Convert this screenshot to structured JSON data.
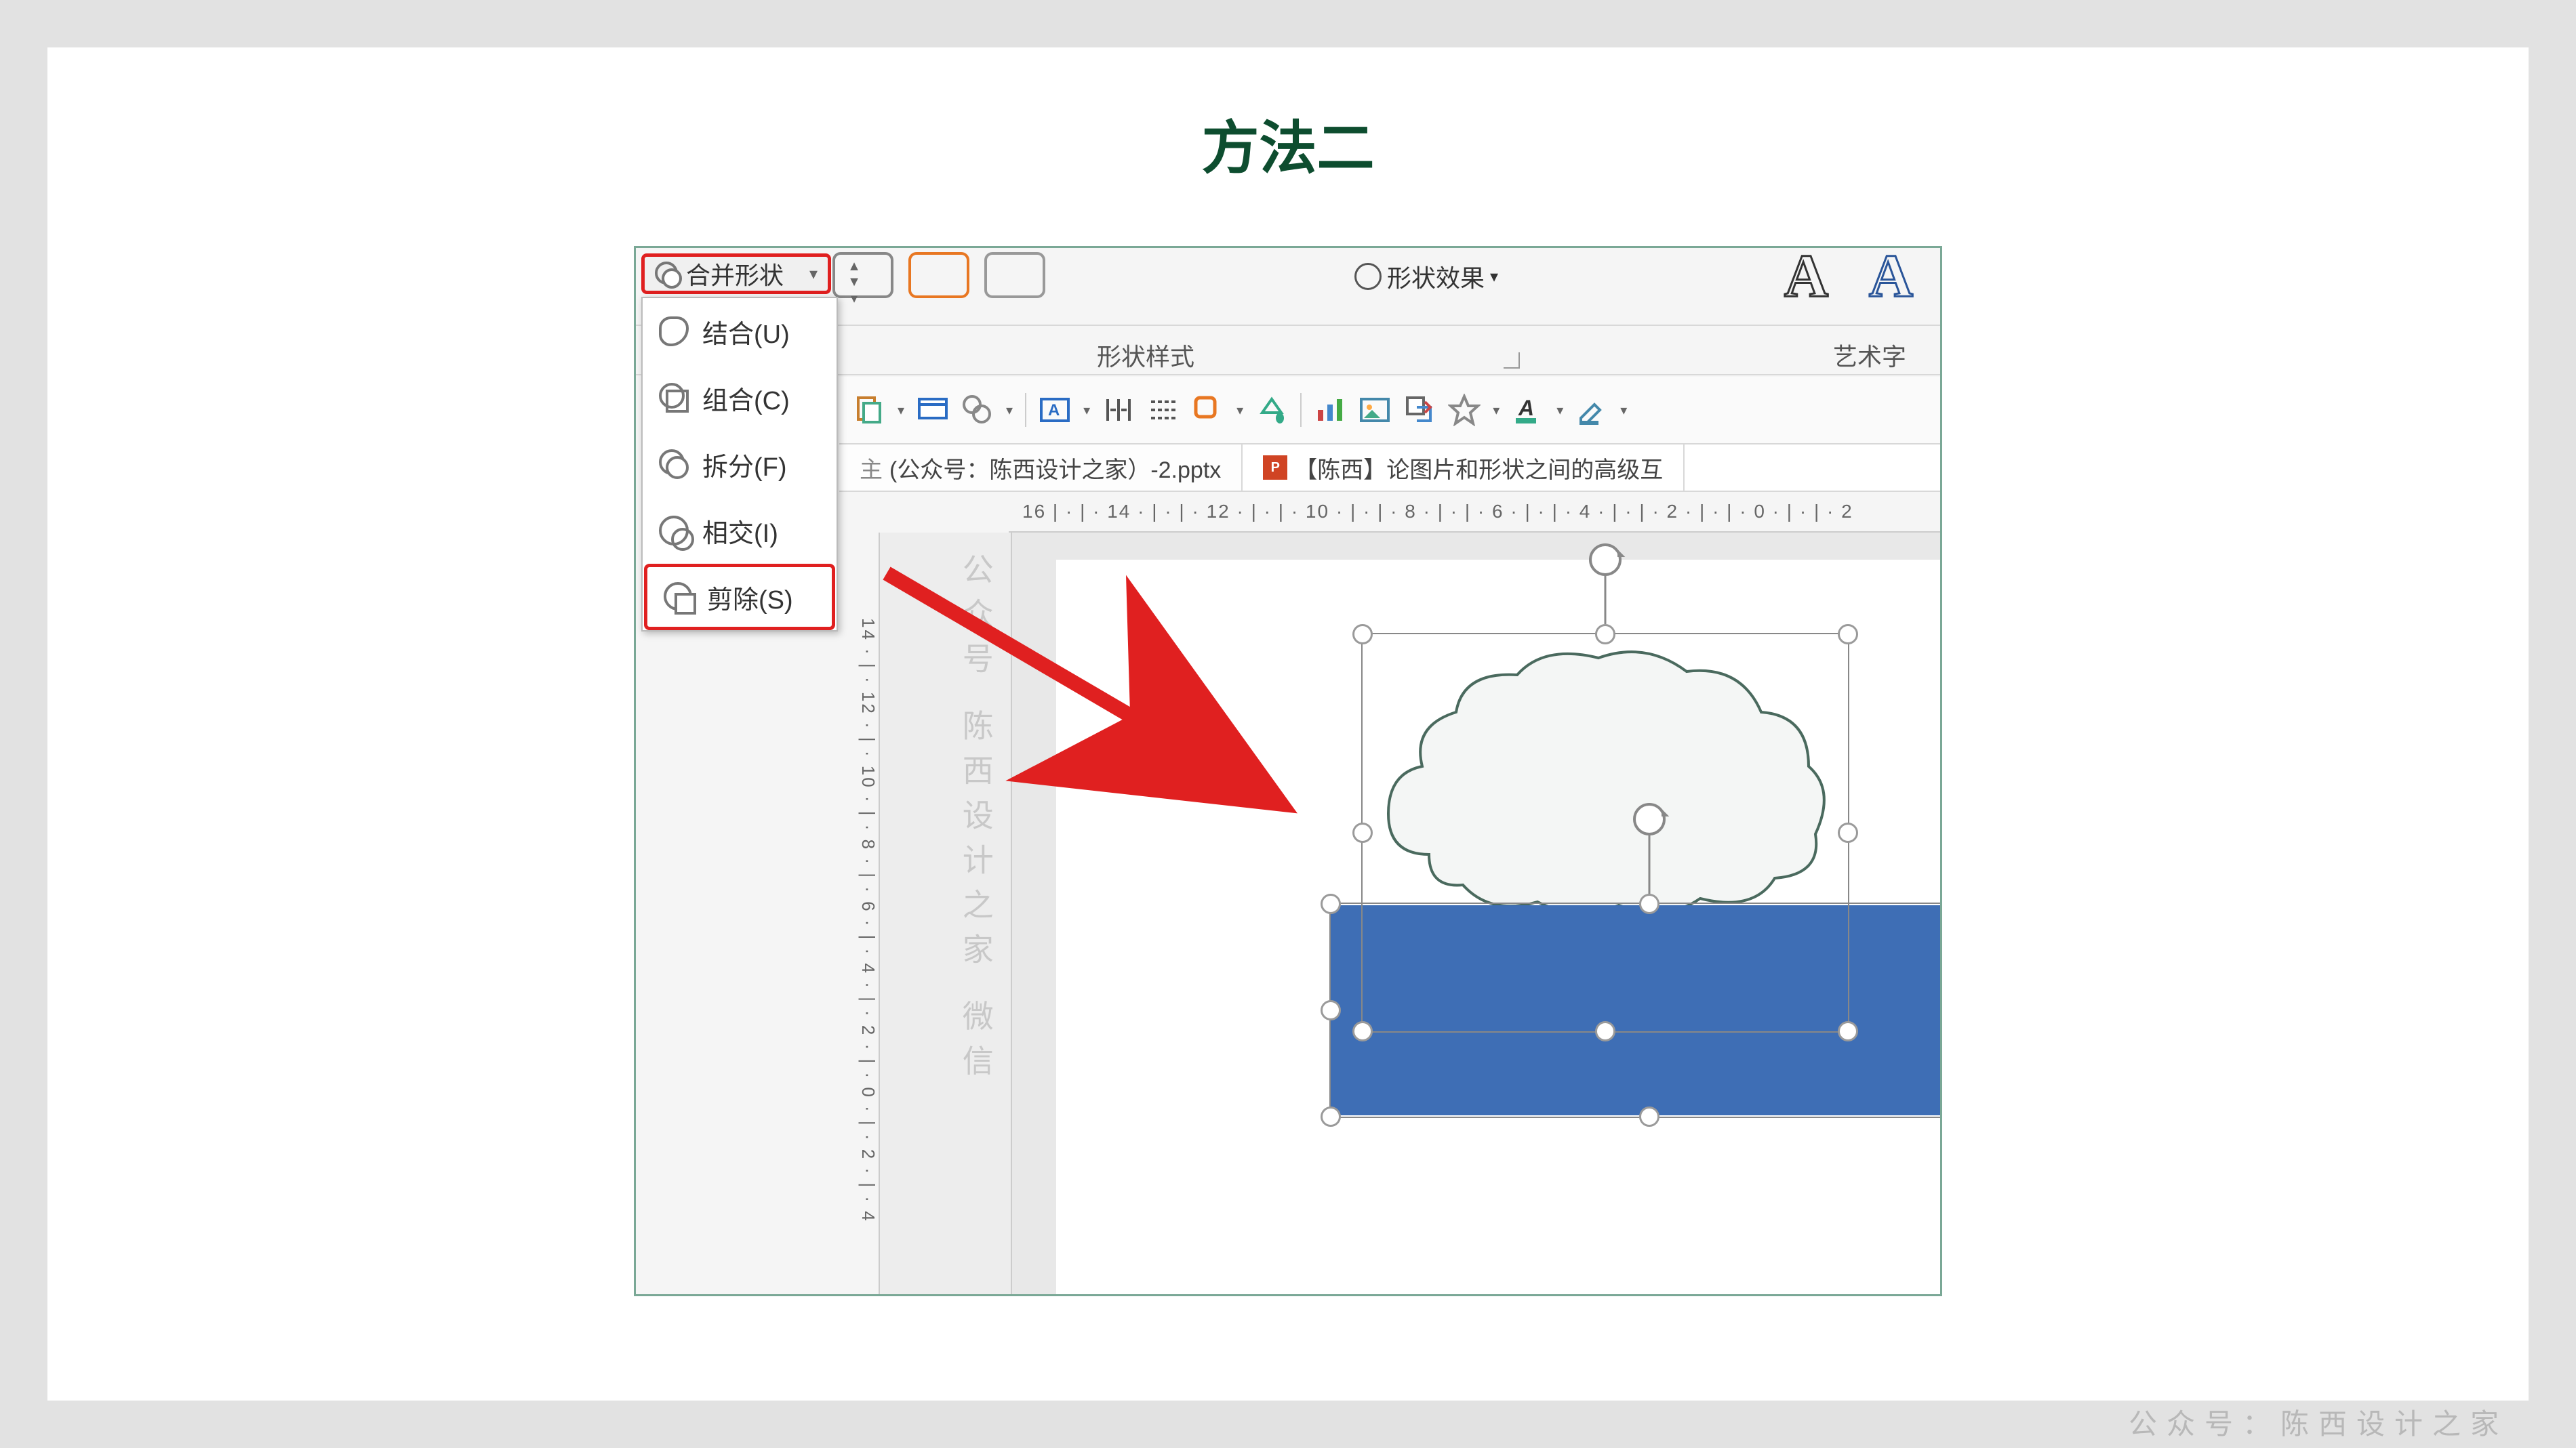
{
  "title": "方法二",
  "ribbon": {
    "merge_shapes_label": "合并形状",
    "shape_effect_label": "形状效果",
    "shape_style_section": "形状样式",
    "art_section": "艺术字",
    "menu": {
      "union": "结合(U)",
      "combine": "组合(C)",
      "fragment": "拆分(F)",
      "intersect": "相交(I)",
      "subtract": "剪除(S)"
    }
  },
  "files": {
    "tab1": "(公众号：陈西设计之家）-2.pptx",
    "tab2": "【陈西】论图片和形状之间的高级互"
  },
  "ruler": {
    "horizontal": "16 | · | · 14 · | · | · 12 · | · | · 10 · | · | · 8 · | · | · 6 · | · | · 4 · | · | · 2 · | · | · 0 · | · | · 2",
    "vertical": "14 · | · 12 · | · 10 · | · 8 · | · 6 · | · 4 · | · 2 · | · 0 · | · 2 · | · 4"
  },
  "watermark": {
    "vertical": "公众号 陈西设计之家 微信",
    "footer": "公众号：陈西设计之家"
  }
}
